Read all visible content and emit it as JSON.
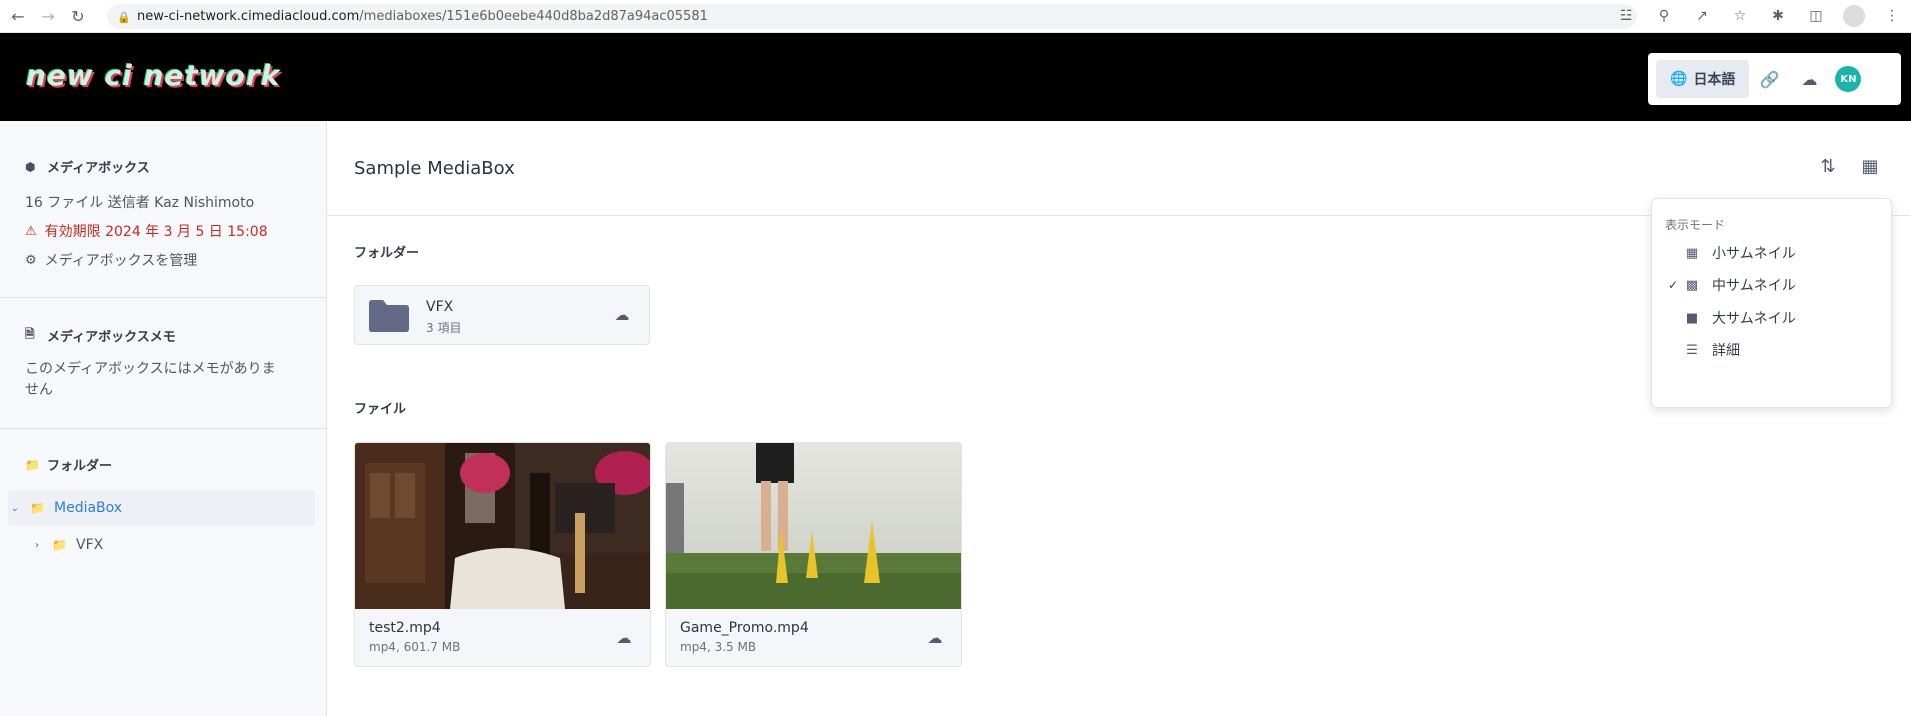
{
  "browser": {
    "url_host": "new-ci-network.cimediacloud.com",
    "url_path": "/mediaboxes/151e6b0eebe440d8ba2d87a94ac05581"
  },
  "header": {
    "brand": "new ci network",
    "language_label": "日本語",
    "avatar_initials": "KN"
  },
  "sidebar": {
    "mediabox_title": "メディアボックス",
    "mediabox_info": "16 ファイル 送信者 Kaz Nishimoto",
    "expiry": "有効期限 2024 年 3 月 5 日 15:08",
    "manage": "メディアボックスを管理",
    "memo_title": "メディアボックスメモ",
    "memo_text": "このメディアボックスにはメモがありません",
    "folders_title": "フォルダー",
    "tree": [
      {
        "label": "MediaBox"
      },
      {
        "label": "VFX"
      }
    ]
  },
  "main": {
    "title": "Sample MediaBox",
    "folders_label": "フォルダー",
    "files_label": "ファイル",
    "folders": [
      {
        "name": "VFX",
        "count": "3 項目"
      }
    ],
    "files": [
      {
        "name": "test2.mp4",
        "meta": "mp4, 601.7 MB"
      },
      {
        "name": "Game_Promo.mp4",
        "meta": "mp4, 3.5 MB"
      }
    ]
  },
  "view_menu": {
    "heading": "表示モード",
    "items": [
      {
        "label": "小サムネイル",
        "checked": false
      },
      {
        "label": "中サムネイル",
        "checked": true
      },
      {
        "label": "大サムネイル",
        "checked": false
      },
      {
        "label": "詳細",
        "checked": false
      }
    ]
  },
  "colors": {
    "accent": "#2a7de1",
    "warning": "#c82a1f",
    "avatar": "#1ab4aa"
  }
}
